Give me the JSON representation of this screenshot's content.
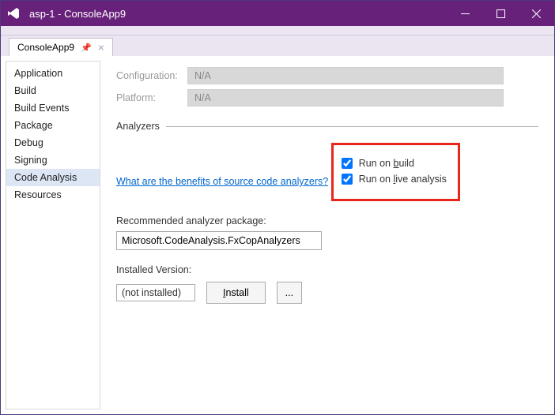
{
  "window": {
    "title": "asp-1 - ConsoleApp9"
  },
  "tab": {
    "label": "ConsoleApp9"
  },
  "sidebar": {
    "items": [
      {
        "label": "Application"
      },
      {
        "label": "Build"
      },
      {
        "label": "Build Events"
      },
      {
        "label": "Package"
      },
      {
        "label": "Debug"
      },
      {
        "label": "Signing"
      },
      {
        "label": "Code Analysis",
        "selected": true
      },
      {
        "label": "Resources"
      }
    ]
  },
  "config": {
    "configuration_label": "Configuration:",
    "configuration_value": "N/A",
    "platform_label": "Platform:",
    "platform_value": "N/A"
  },
  "section": {
    "analyzers": "Analyzers"
  },
  "help_link": "What are the benefits of source code analyzers?",
  "checkboxes": {
    "run_on_build_pre": "Run on ",
    "run_on_build_u": "b",
    "run_on_build_post": "uild",
    "run_on_live_pre": "Run on ",
    "run_on_live_u": "l",
    "run_on_live_post": "ive analysis"
  },
  "recommended": {
    "label": "Recommended analyzer package:",
    "value": "Microsoft.CodeAnalysis.FxCopAnalyzers"
  },
  "installed": {
    "label": "Installed Version:",
    "value": "(not installed)",
    "install_btn_pre": "",
    "install_btn_u": "I",
    "install_btn_post": "nstall",
    "browse_btn": "..."
  }
}
